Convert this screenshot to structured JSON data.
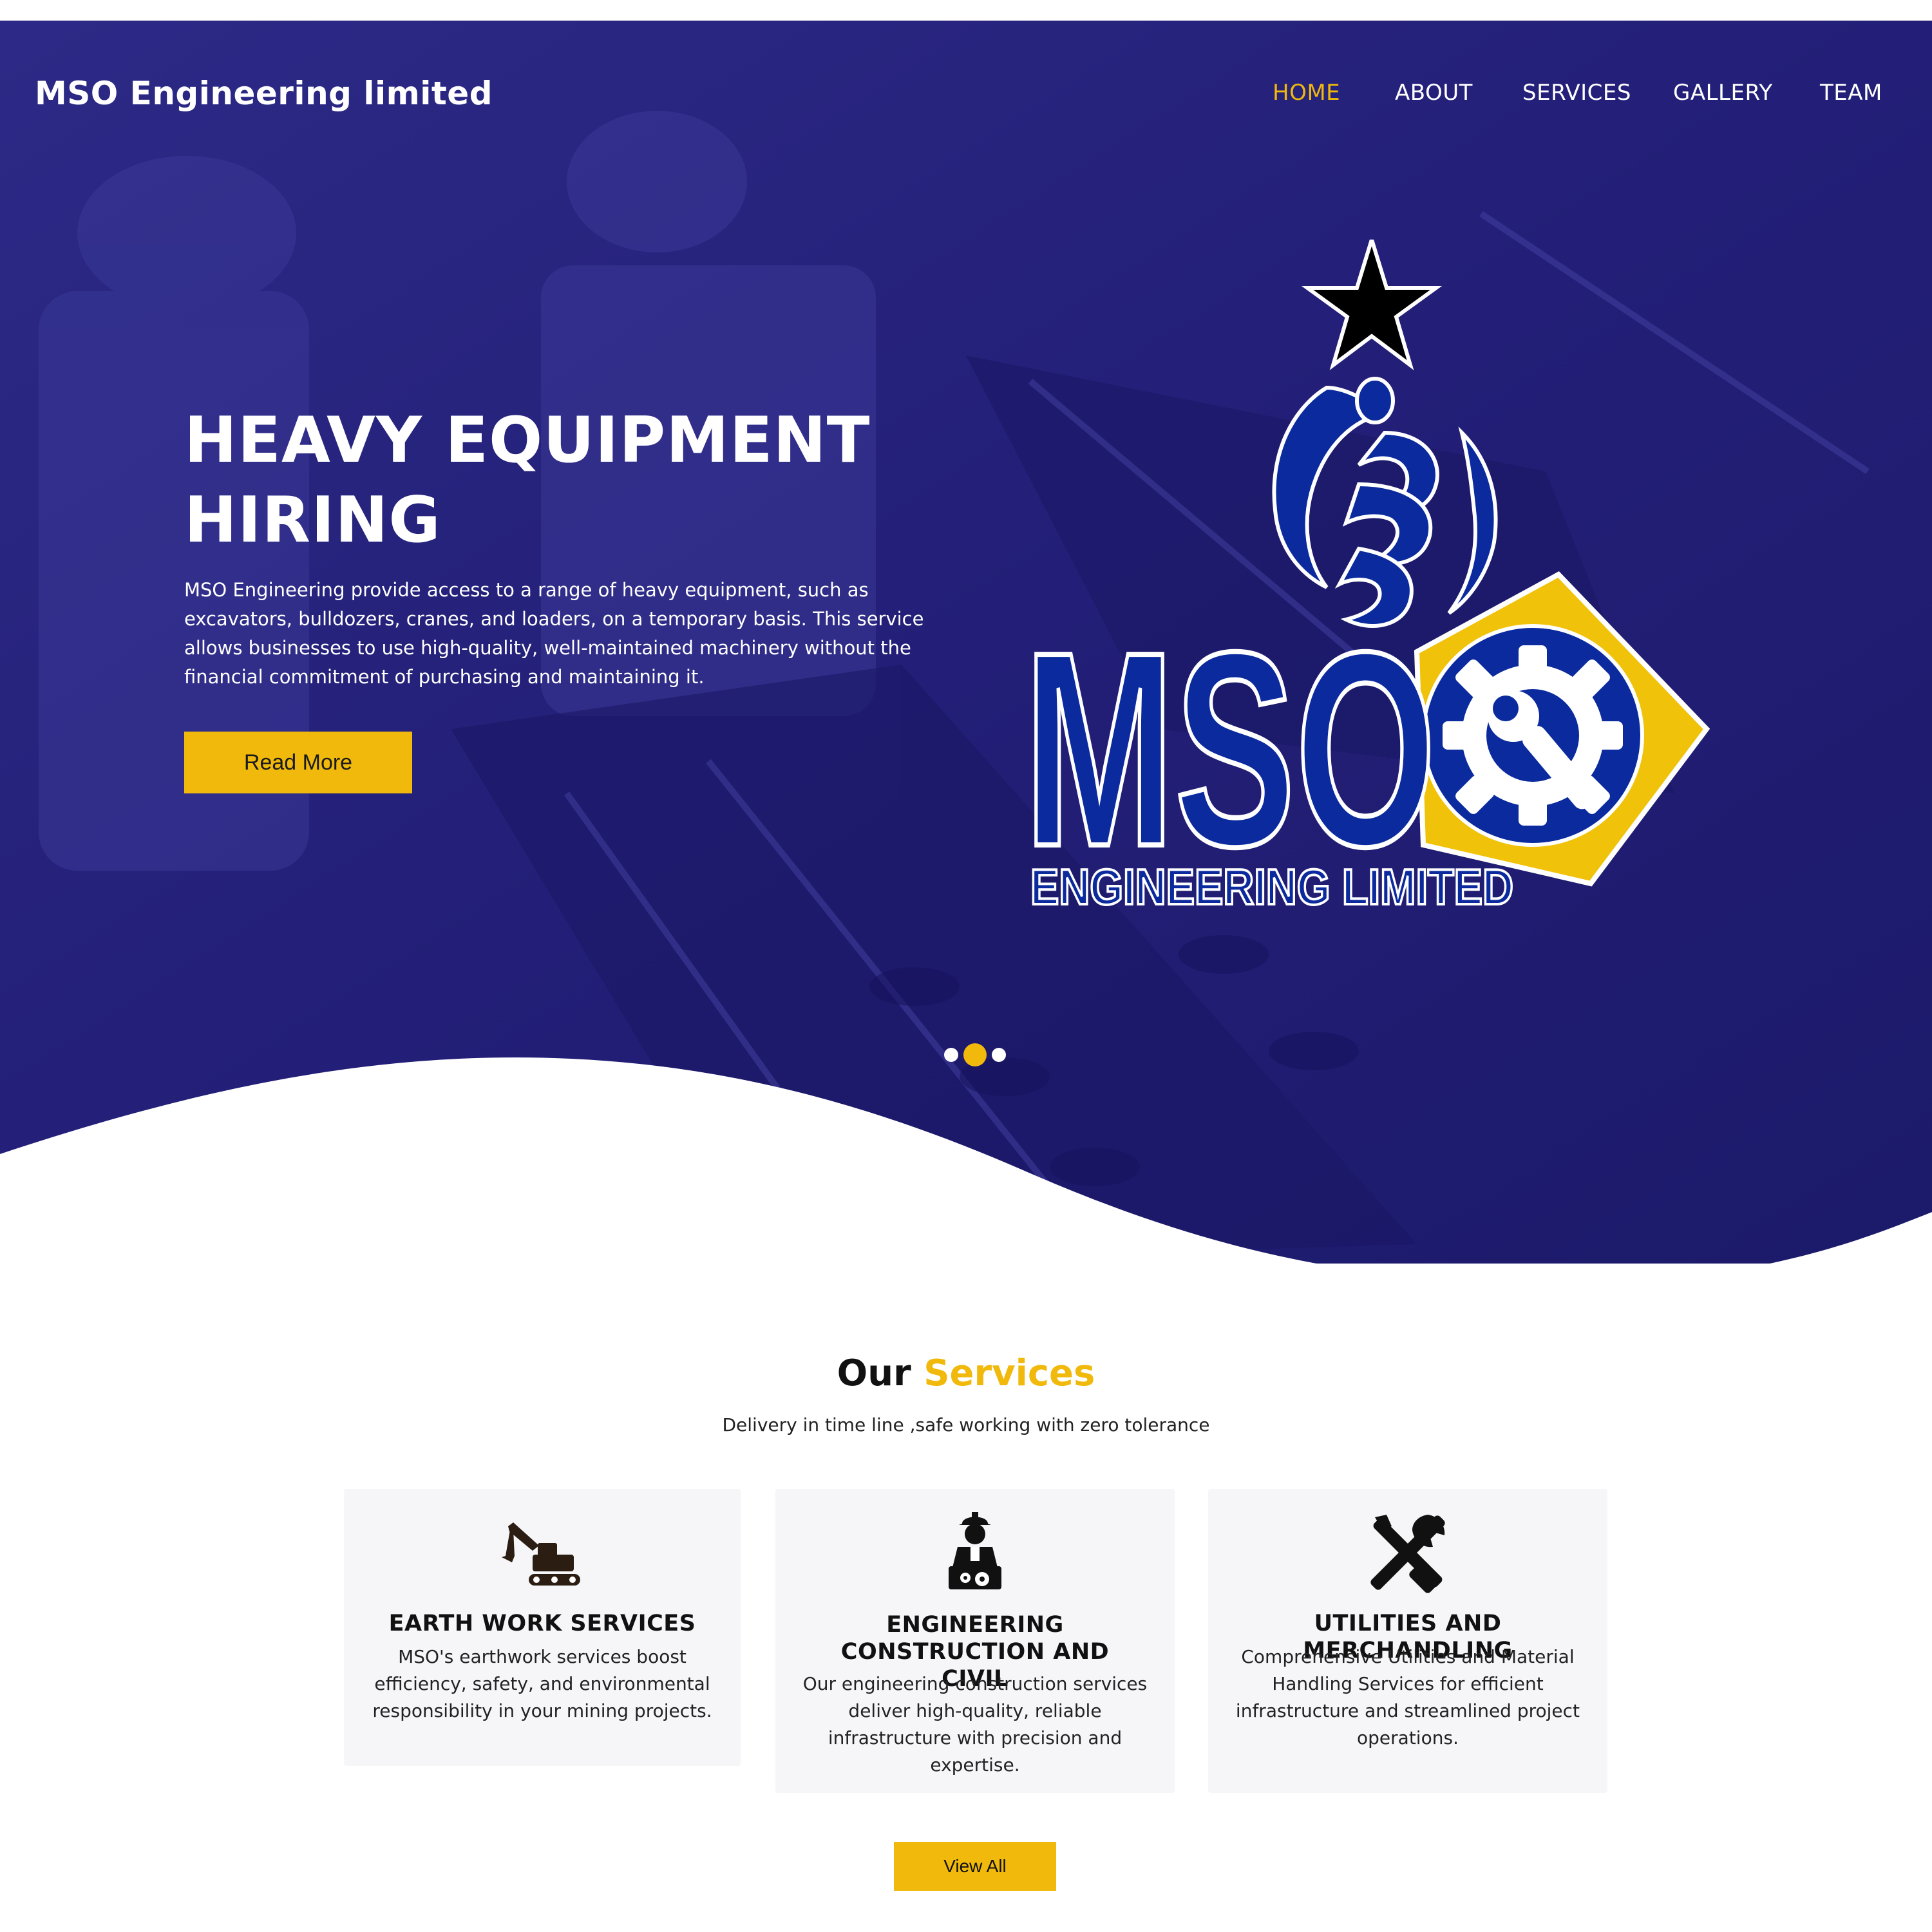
{
  "site": {
    "brand": "MSO Engineering limited"
  },
  "nav": {
    "items": [
      {
        "label": "HOME",
        "active": true
      },
      {
        "label": "ABOUT",
        "active": false
      },
      {
        "label": "SERVICES",
        "active": false
      },
      {
        "label": "GALLERY",
        "active": false
      },
      {
        "label": "TEAM",
        "active": false
      }
    ]
  },
  "hero": {
    "headline_line1": "HEAVY EQUIPMENT",
    "headline_line2": "HIRING",
    "text": "MSO Engineering provide access to a range of heavy equipment, such as excavators, bulldozers, cranes, and loaders, on a temporary basis. This service allows businesses to use high-quality, well-maintained machinery without the financial commitment of purchasing and maintaining it.",
    "button_label": "Read More",
    "slides_total": 3,
    "slide_active": 2
  },
  "logo": {
    "wordmark": "MSO",
    "tagline": "ENGINEERING LIMITED"
  },
  "services": {
    "title_part1": "Our ",
    "title_part2": "Services",
    "subtitle": "Delivery in time line ,safe working with zero tolerance",
    "cards": [
      {
        "icon": "excavator-icon",
        "title": "EARTH WORK SERVICES",
        "text": "MSO's earthwork services boost efficiency, safety, and environmental responsibility in your mining projects."
      },
      {
        "icon": "engineer-icon",
        "title": "ENGINEERING CONSTRUCTION AND CIVIL",
        "text": "Our engineering construction services deliver high-quality, reliable infrastructure with precision and expertise."
      },
      {
        "icon": "tools-icon",
        "title": "UTILITIES AND MERCHANDLING",
        "text": "Comprehensive Utilities and Material Handling Services for efficient infrastructure and streamlined project operations."
      }
    ],
    "view_all_label": "View All"
  },
  "colors": {
    "hero_overlay": "#23207a",
    "accent": "#f0b90b",
    "logo_blue": "#0a2a9e",
    "card_bg": "#f6f6f8"
  }
}
